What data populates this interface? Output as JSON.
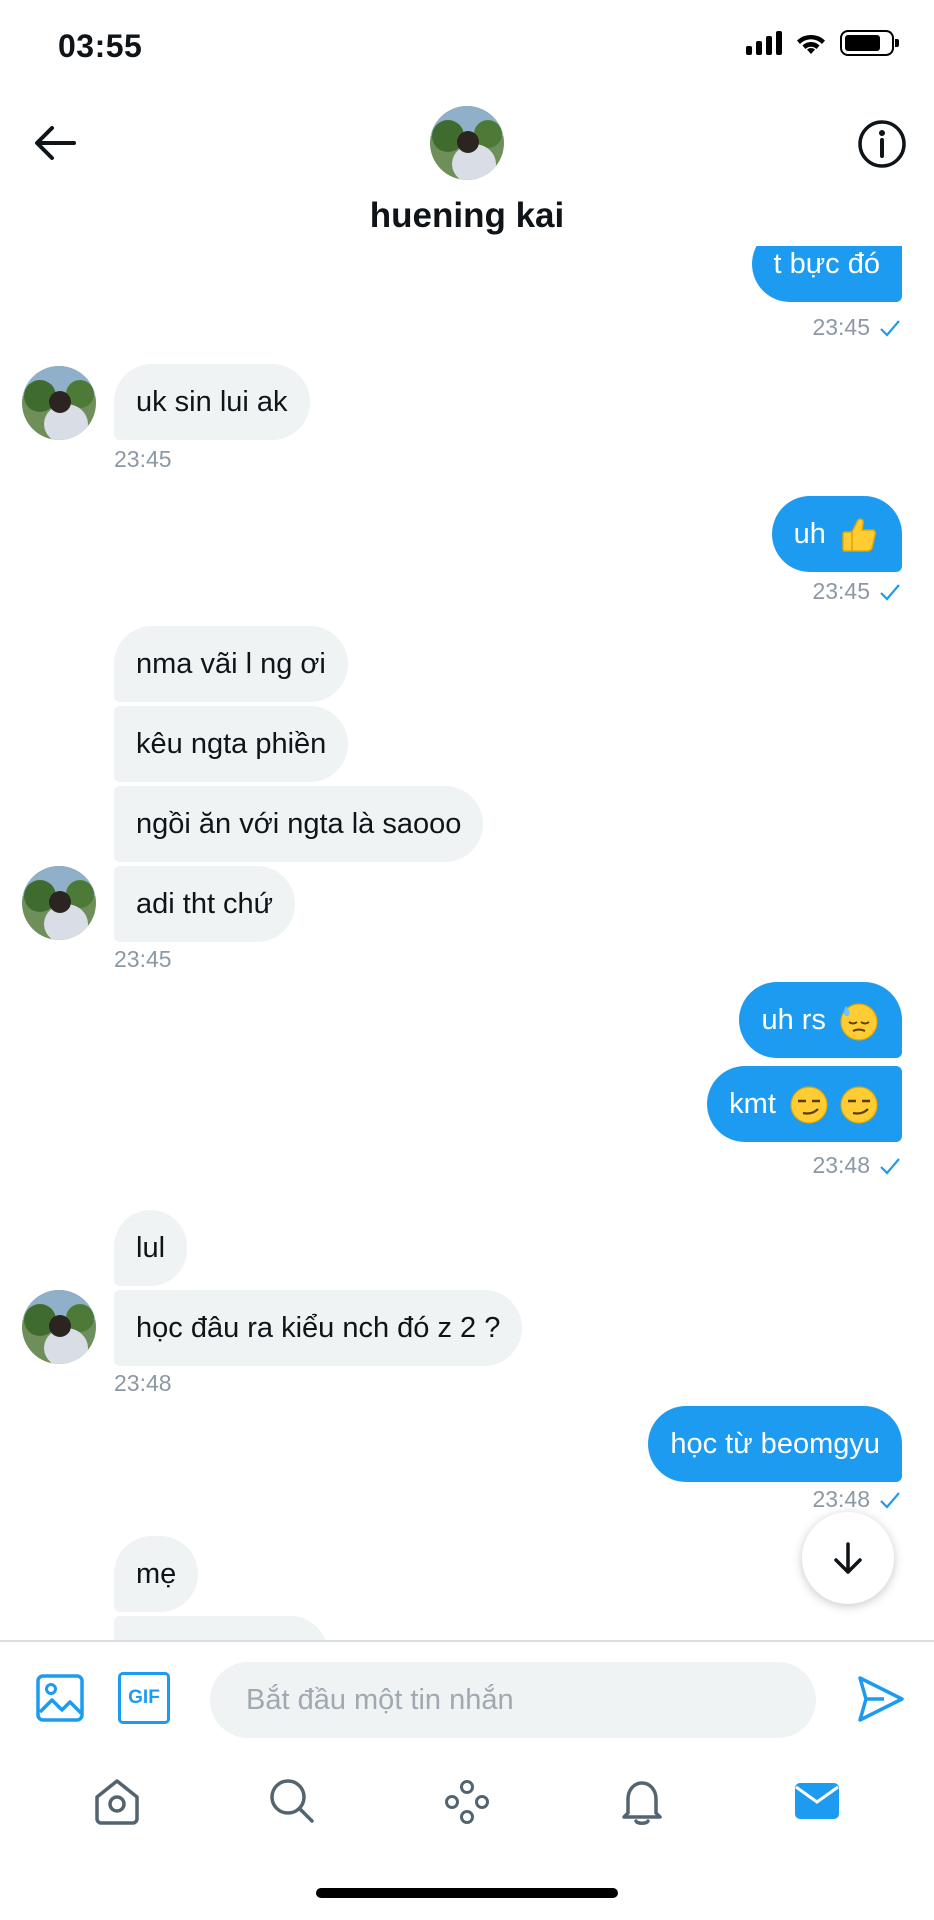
{
  "status_bar": {
    "time": "03:55",
    "battery_level": 0.8
  },
  "header": {
    "contact_name": "huening kai",
    "back_icon": "arrow-left-icon",
    "info_icon": "info-icon"
  },
  "messages": [
    {
      "side": "sent",
      "text": "t bực đó"
    },
    {
      "side": "sent_ts",
      "time": "23:45"
    },
    {
      "side": "recv",
      "text": "uk sin lui ak"
    },
    {
      "side": "recv_ts",
      "time": "23:45"
    },
    {
      "side": "sent",
      "text": "uh",
      "emoji": "thumbs-up"
    },
    {
      "side": "sent_ts",
      "time": "23:45"
    },
    {
      "side": "recv",
      "text": "nma vãi l ng ơi"
    },
    {
      "side": "recv",
      "text": "kêu ngta phiền"
    },
    {
      "side": "recv",
      "text": "ngồi ăn với ngta là saooo"
    },
    {
      "side": "recv",
      "text": "adi tht chứ"
    },
    {
      "side": "recv_ts",
      "time": "23:45"
    },
    {
      "side": "sent",
      "text": "uh rs",
      "emoji": "downcast-sweat"
    },
    {
      "side": "sent",
      "text": "kmt",
      "emoji": "smirk x2"
    },
    {
      "side": "sent_ts",
      "time": "23:48"
    },
    {
      "side": "recv",
      "text": "lul"
    },
    {
      "side": "recv",
      "text": "học đâu ra kiểu nch đó z 2 ?"
    },
    {
      "side": "recv_ts",
      "time": "23:48"
    },
    {
      "side": "sent",
      "text": "học từ beomgyu"
    },
    {
      "side": "sent_ts",
      "time": "23:48"
    },
    {
      "side": "recv",
      "text": "mẹ"
    }
  ],
  "composer": {
    "placeholder": "Bắt đầu một tin nhắn",
    "media_icon": "image-icon",
    "gif_label": "GIF",
    "send_icon": "send-icon"
  },
  "tabs": [
    "home-icon",
    "search-icon",
    "spaces-icon",
    "notifications-icon",
    "messages-icon"
  ],
  "colors": {
    "accent": "#1d9bf0",
    "received_bubble": "#eff3f4",
    "timestamp": "#8b98a5"
  }
}
